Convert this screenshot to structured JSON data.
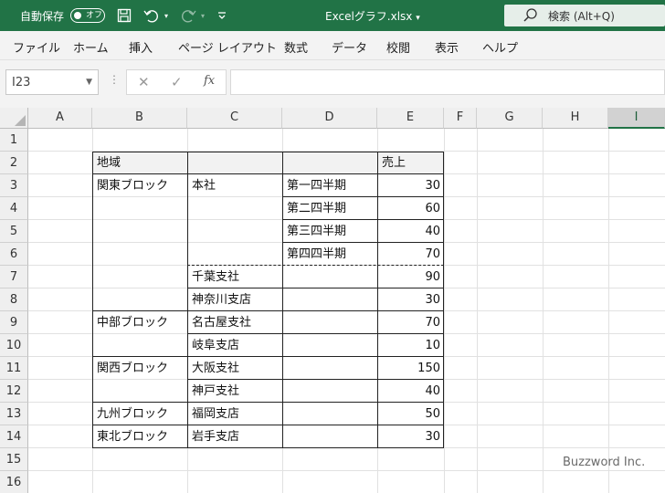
{
  "titlebar": {
    "autosave_label": "自動保存",
    "autosave_state": "オフ",
    "filename": "Excelグラフ.xlsx",
    "search_label": "検索 (Alt+Q)",
    "icons": [
      "save-icon",
      "undo-icon",
      "redo-icon",
      "customize-icon",
      "search-icon"
    ]
  },
  "menu": [
    "ファイル",
    "ホーム",
    "挿入",
    "ページ レイアウト",
    "数式",
    "データ",
    "校閲",
    "表示",
    "ヘルプ"
  ],
  "formula_bar": {
    "name_box": "I23",
    "fx_label": "fx",
    "formula": ""
  },
  "columns": [
    "A",
    "B",
    "C",
    "D",
    "E",
    "F",
    "G",
    "H",
    "I"
  ],
  "selected_column": "I",
  "rows": [
    "1",
    "2",
    "3",
    "4",
    "5",
    "6",
    "7",
    "8",
    "9",
    "10",
    "11",
    "12",
    "13",
    "14",
    "15",
    "16"
  ],
  "table": {
    "header_region": "地域",
    "header_sales": "売上",
    "regions": [
      "関東ブロック",
      "中部ブロック",
      "関西ブロック",
      "九州ブロック",
      "東北ブロック"
    ],
    "branches": [
      "本社",
      "千葉支社",
      "神奈川支店",
      "名古屋支社",
      "岐阜支店",
      "大阪支社",
      "神戸支社",
      "福岡支店",
      "岩手支店"
    ],
    "quarters": [
      "第一四半期",
      "第二四半期",
      "第三四半期",
      "第四四半期"
    ],
    "sales": [
      "30",
      "60",
      "40",
      "70",
      "90",
      "30",
      "70",
      "10",
      "150",
      "40",
      "50",
      "30"
    ]
  },
  "watermark": "Buzzword Inc.",
  "colors": {
    "accent": "#217346"
  }
}
